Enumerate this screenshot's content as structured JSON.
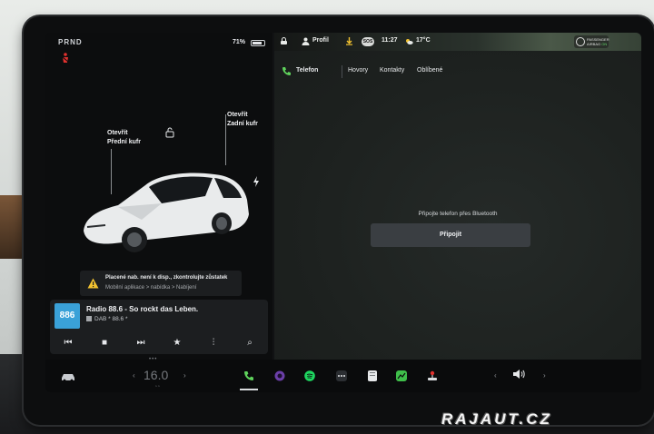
{
  "status": {
    "gear": "PRND",
    "battery_percent": "71%",
    "profile": "Profil",
    "sos": "SOS",
    "time": "11:27",
    "temperature": "17°C",
    "passenger_airbag": {
      "line1": "PASSENGER",
      "line2": "AIRBAG",
      "state": "ON"
    }
  },
  "car": {
    "front_trunk": {
      "line1": "Otevřít",
      "line2": "Přední kufr"
    },
    "rear_trunk": {
      "line1": "Otevřít",
      "line2": "Zadní kufr"
    },
    "warning": {
      "title": "Placené nab. není k disp., zkontrolujte zůstatek",
      "subtitle": "Mobilní aplikace > nabídka > Nabíjení"
    }
  },
  "media": {
    "station_logo": "886",
    "station_name": "Radio 88.6 - So rockt das Leben.",
    "station_sub": "DAB * 88.6 *"
  },
  "phone": {
    "tabs": [
      "Telefon",
      "Hovory",
      "Kontakty",
      "Oblíbené"
    ],
    "prompt": "Připojte telefon přes Bluetooth",
    "connect_label": "Připojit"
  },
  "dock": {
    "temperature": "16.0",
    "temp_left_arrow": "‹",
    "temp_right_arrow": "›",
    "vol_left_arrow": "‹",
    "vol_right_arrow": "›"
  },
  "colors": {
    "accent_green": "#5fd35c",
    "warning_yellow": "#f2c230",
    "seatbelt_red": "#e0312e",
    "spotify_green": "#1ed760",
    "station_blue": "#3aa1d8"
  },
  "watermark": "RAJAUT.CZ"
}
